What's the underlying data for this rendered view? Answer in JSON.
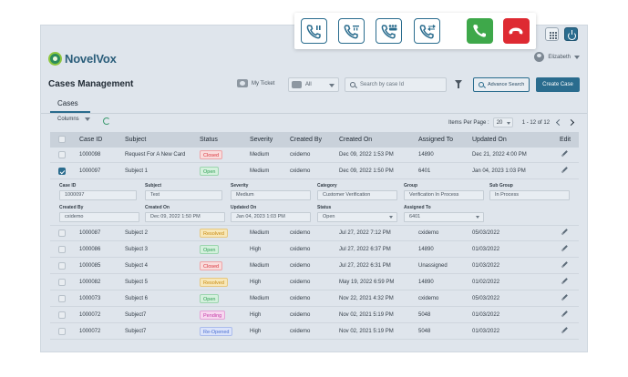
{
  "colors": {
    "primary": "#2a6c8e",
    "accept_green": "#3ea84a",
    "reject_red": "#de2a32",
    "status_closed": "#d9363e",
    "status_open": "#2e9e55",
    "status_resolved": "#c98b13",
    "status_pending": "#c43aa8",
    "status_reopened": "#4a6fd1"
  },
  "call_controls": [
    {
      "name": "hold-call-button",
      "icon": "phone-pause-icon"
    },
    {
      "name": "transfer-call-button",
      "icon": "phone-transfer-icon"
    },
    {
      "name": "conference-call-button",
      "icon": "phone-conference-icon"
    },
    {
      "name": "merge-call-button",
      "icon": "phone-merge-icon"
    },
    {
      "name": "answer-call-button",
      "icon": "phone-answer-icon"
    },
    {
      "name": "end-call-button",
      "icon": "phone-hangup-icon"
    }
  ],
  "header": {
    "logo_text": "NovelVox",
    "user_name": "Elizabeth"
  },
  "title_bar": {
    "page_title": "Cases Management",
    "my_ticket": "My Ticket",
    "filter_value": "All",
    "search_placeholder": "Search by case Id",
    "advance_search": "Advance Search",
    "create_case": "Create Case"
  },
  "tabs": {
    "cases": "Cases"
  },
  "toolbar": {
    "columns": "Columns",
    "items_per_page_label": "Items Per Page :",
    "items_per_page": "20",
    "range": "1 - 12 of 12"
  },
  "table": {
    "columns": [
      "Case ID",
      "Subject",
      "Status",
      "Severity",
      "Created By",
      "Created On",
      "Assigned To",
      "Updated On",
      "Edit"
    ],
    "rows": [
      {
        "case_id": "1000098",
        "subject": "Request For A New Card",
        "status": "Closed",
        "severity": "Medium",
        "created_by": "cxidemo",
        "created_on": "Dec 09, 2022 1:53 PM",
        "assigned_to": "14890",
        "updated_on": "Dec 21, 2022 4:00 PM",
        "checked": false
      },
      {
        "case_id": "1000097",
        "subject": "Subject 1",
        "status": "Open",
        "severity": "Medium",
        "created_by": "cxidemo",
        "created_on": "Dec 09, 2022 1:50 PM",
        "assigned_to": "6401",
        "updated_on": "Jan 04, 2023 1:03 PM",
        "checked": true
      },
      {
        "case_id": "1000087",
        "subject": "Subject 2",
        "status": "Resolved",
        "severity": "Medium",
        "created_by": "cxidemo",
        "created_on": "Jul 27, 2022 7:12 PM",
        "assigned_to": "cxidemo",
        "updated_on": "05/03/2022",
        "checked": false
      },
      {
        "case_id": "1000086",
        "subject": "Subject 3",
        "status": "Open",
        "severity": "High",
        "created_by": "cxidemo",
        "created_on": "Jul 27, 2022 6:37 PM",
        "assigned_to": "14890",
        "updated_on": "01/03/2022",
        "checked": false
      },
      {
        "case_id": "1000085",
        "subject": "Subject 4",
        "status": "Closed",
        "severity": "Medium",
        "created_by": "cxidemo",
        "created_on": "Jul 27, 2022 6:31 PM",
        "assigned_to": "Unassigned",
        "updated_on": "01/03/2022",
        "checked": false
      },
      {
        "case_id": "1000082",
        "subject": "Subject 5",
        "status": "Resolved",
        "severity": "High",
        "created_by": "cxidemo",
        "created_on": "May 19, 2022 6:59 PM",
        "assigned_to": "14890",
        "updated_on": "01/02/2022",
        "checked": false
      },
      {
        "case_id": "1000073",
        "subject": "Subject 6",
        "status": "Open",
        "severity": "Medium",
        "created_by": "cxidemo",
        "created_on": "Nov 22, 2021 4:32 PM",
        "assigned_to": "cxidemo",
        "updated_on": "05/03/2022",
        "checked": false
      },
      {
        "case_id": "1000072",
        "subject": "Subject7",
        "status": "Pending",
        "severity": "High",
        "created_by": "cxidemo",
        "created_on": "Nov 02, 2021 5:19 PM",
        "assigned_to": "5048",
        "updated_on": "01/03/2022",
        "checked": false
      },
      {
        "case_id": "1000072",
        "subject": "Subject7",
        "status": "Re-Opened",
        "severity": "High",
        "created_by": "cxidemo",
        "created_on": "Nov 02, 2021 5:19 PM",
        "assigned_to": "5048",
        "updated_on": "01/03/2022",
        "checked": false
      }
    ]
  },
  "detail": {
    "case_id_label": "Case ID",
    "case_id": "1000097",
    "subject_label": "Subject",
    "subject": "Test",
    "severity_label": "Severity",
    "severity": "Medium",
    "category_label": "Category",
    "category": "Customer Verification",
    "group_label": "Group",
    "group": "Verification In Process",
    "sub_group_label": "Sub Group",
    "sub_group": "In Process",
    "created_by_label": "Created By",
    "created_by": "cxidemo",
    "created_on_label": "Created On",
    "created_on": "Dec 09, 2022 1:50 PM",
    "updated_on_label": "Updated On",
    "updated_on": "Jan 04, 2023 1:03 PM",
    "status_label": "Status",
    "status": "Open",
    "assigned_to_label": "Assigned To",
    "assigned_to": "6401"
  }
}
